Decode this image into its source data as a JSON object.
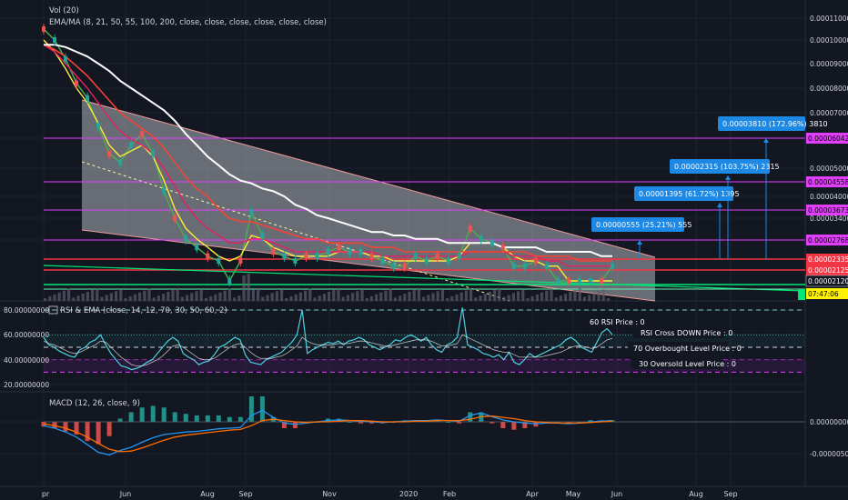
{
  "chart_data": [
    {
      "type": "line",
      "indicators": [
        "Vol (20)",
        "EMA/MA (8, 21, 50, 55, 100, 200, close, close, close, close, close, close)"
      ],
      "x_ticks": [
        "pr",
        "Jun",
        "Aug",
        "Sep",
        "Nov",
        "2020",
        "Feb",
        "Apr",
        "May",
        "Jun",
        "Aug",
        "Sep"
      ],
      "y_ticks": [
        "0.00011000",
        "0.00010000",
        "0.00009000",
        "0.00008000",
        "0.00007000",
        "0.00005000",
        "0.00004000",
        "0.00003400"
      ],
      "series": [
        {
          "values": [
            0.000105,
            0.0001,
            9.2e-05,
            8.2e-05,
            7.6e-05,
            6.5e-05,
            5.5e-05,
            5.2e-05,
            5.8e-05,
            6.2e-05,
            5.5e-05,
            4.2e-05,
            3.4e-05,
            2.8e-05,
            2.6e-05,
            2.4e-05,
            2.3e-05,
            2.1e-05,
            2.3e-05,
            3.6e-05,
            2.9e-05,
            2.5e-05,
            2.4e-05,
            2.3e-05,
            2.4e-05,
            2.4e-05,
            2.5e-05,
            2.6e-05,
            2.5e-05,
            2.5e-05,
            2.4e-05,
            2.3e-05,
            2.2e-05,
            2.2e-05,
            2.4e-05,
            2.3e-05,
            2.4e-05,
            2.3e-05,
            2.4e-05,
            3.1e-05,
            2.8e-05,
            2.7e-05,
            2.6e-05,
            2.2e-05,
            2.2e-05,
            2.3e-05,
            2.2e-05,
            2.1e-05,
            2.1e-05,
            2.1e-05,
            2.1e-05,
            2.1e-05,
            2.2e-05
          ]
        },
        {
          "values": [
            0.0001,
            9.5e-05,
            8.8e-05,
            8e-05,
            7.4e-05,
            6.6e-05,
            5.8e-05,
            5.4e-05,
            5.6e-05,
            5.8e-05,
            5.4e-05,
            4.6e-05,
            3.7e-05,
            3.1e-05,
            2.8e-05,
            2.6e-05,
            2.4e-05,
            2.3e-05,
            2.4e-05,
            2.9e-05,
            2.8e-05,
            2.6e-05,
            2.5e-05,
            2.4e-05,
            2.4e-05,
            2.4e-05,
            2.4e-05,
            2.5e-05,
            2.5e-05,
            2.5e-05,
            2.4e-05,
            2.4e-05,
            2.3e-05,
            2.3e-05,
            2.3e-05,
            2.3e-05,
            2.3e-05,
            2.3e-05,
            2.4e-05,
            2.7e-05,
            2.7e-05,
            2.7e-05,
            2.6e-05,
            2.4e-05,
            2.3e-05,
            2.3e-05,
            2.2e-05,
            2.2e-05,
            2.1e-05,
            2.1e-05,
            2.1e-05,
            2.1e-05,
            2.1e-05
          ]
        },
        {
          "values": [
            9.8e-05,
            9.5e-05,
            9e-05,
            8.5e-05,
            8e-05,
            7.4e-05,
            6.8e-05,
            6.3e-05,
            6e-05,
            5.8e-05,
            5.5e-05,
            5e-05,
            4.4e-05,
            3.8e-05,
            3.4e-05,
            3.1e-05,
            2.9e-05,
            2.7e-05,
            2.7e-05,
            2.8e-05,
            2.8e-05,
            2.7e-05,
            2.6e-05,
            2.5e-05,
            2.5e-05,
            2.5e-05,
            2.5e-05,
            2.5e-05,
            2.5e-05,
            2.5e-05,
            2.5e-05,
            2.4e-05,
            2.4e-05,
            2.4e-05,
            2.4e-05,
            2.4e-05,
            2.4e-05,
            2.4e-05,
            2.4e-05,
            2.5e-05,
            2.5e-05,
            2.5e-05,
            2.5e-05,
            2.4e-05,
            2.4e-05,
            2.4e-05,
            2.3e-05,
            2.3e-05,
            2.2e-05,
            2.2e-05,
            2.2e-05,
            2.2e-05,
            2.2e-05
          ]
        },
        {
          "values": [
            9.8e-05,
            9.6e-05,
            9.3e-05,
            8.9e-05,
            8.5e-05,
            8e-05,
            7.5e-05,
            7e-05,
            6.7e-05,
            6.4e-05,
            6.1e-05,
            5.7e-05,
            5.2e-05,
            4.7e-05,
            4.3e-05,
            4e-05,
            3.7e-05,
            3.4e-05,
            3.3e-05,
            3.3e-05,
            3.2e-05,
            3.1e-05,
            3e-05,
            2.9e-05,
            2.8e-05,
            2.8e-05,
            2.7e-05,
            2.7e-05,
            2.7e-05,
            2.7e-05,
            2.6e-05,
            2.6e-05,
            2.6e-05,
            2.5e-05,
            2.5e-05,
            2.5e-05,
            2.5e-05,
            2.5e-05,
            2.5e-05,
            2.5e-05,
            2.5e-05,
            2.5e-05,
            2.5e-05,
            2.5e-05,
            2.5e-05,
            2.4e-05,
            2.4e-05,
            2.4e-05,
            2.4e-05,
            2.3e-05,
            2.3e-05,
            2.3e-05,
            2.3e-05
          ]
        },
        {
          "values": [
            9.8e-05,
            9.8e-05,
            9.7e-05,
            9.5e-05,
            9.3e-05,
            9e-05,
            8.7e-05,
            8.3e-05,
            8e-05,
            7.7e-05,
            7.4e-05,
            7.1e-05,
            6.7e-05,
            6.2e-05,
            5.8e-05,
            5.4e-05,
            5.1e-05,
            4.8e-05,
            4.6e-05,
            4.5e-05,
            4.3e-05,
            4.2e-05,
            4e-05,
            3.8e-05,
            3.7e-05,
            3.5e-05,
            3.4e-05,
            3.3e-05,
            3.2e-05,
            3.1e-05,
            3e-05,
            3e-05,
            2.9e-05,
            2.9e-05,
            2.8e-05,
            2.8e-05,
            2.8e-05,
            2.7e-05,
            2.7e-05,
            2.7e-05,
            2.7e-05,
            2.7e-05,
            2.6e-05,
            2.6e-05,
            2.6e-05,
            2.6e-05,
            2.5e-05,
            2.5e-05,
            2.5e-05,
            2.5e-05,
            2.5e-05,
            2.4e-05,
            2.4e-05
          ]
        }
      ],
      "overlays": {
        "horizontal_levels": [
          6.042e-05,
          4.558e-05,
          3.673e-05,
          2.768e-05,
          2.335e-05,
          2.125e-05
        ],
        "price_tags": [
          {
            "text": "0.00006042",
            "color": "#e040fb",
            "text_color": "#000000"
          },
          {
            "text": "0.00004558",
            "color": "#e040fb",
            "text_color": "#000000"
          },
          {
            "text": "0.00003673",
            "color": "#e040fb",
            "text_color": "#000000"
          },
          {
            "text": "0.00002768",
            "color": "#e040fb",
            "text_color": "#000000"
          },
          {
            "text": "0.00002335",
            "color": "#f23645",
            "text_color": "#ffffff"
          },
          {
            "text": "0.00002125",
            "color": "#f23645",
            "text_color": "#ffffff"
          },
          {
            "text": "0.00002120",
            "color": "#131722",
            "text_color": "#ffffff"
          },
          {
            "text": "07:47:06",
            "color": "#fff200",
            "text_color": "#000000"
          }
        ],
        "target_boxes": [
          "0.00000555 (25.21%) 555",
          "0.00001395 (61.72%) 1395",
          "0.00002315 (103.75%) 2315",
          "0.00003810 (172.96%) 3810"
        ]
      },
      "colors": {
        "background": "#131722",
        "ema8": "#4caf50",
        "ema21": "#ffeb3b",
        "ema50": "#e91e63",
        "ma100": "#f44336",
        "ma200": "#ffffff",
        "channel": "#d1d4dc",
        "level": "#e040fb",
        "target": "#1e88e5"
      }
    },
    {
      "type": "line",
      "title": "RSI & EMA (close, 14, 12, 70, 30, 50, 60, 2)",
      "y_ticks": [
        "80.00000000",
        "60.00000000",
        "40.00000000",
        "20.00000000"
      ],
      "labels": [
        "60 RSI Price : 0",
        "RSI Cross DOWN Price : 0",
        "70 Overbought Level Price : 0",
        "30 Oversold Level Price : 0"
      ],
      "series": [
        {
          "values": [
            58,
            52,
            50,
            47,
            45,
            43,
            42,
            48,
            50,
            54,
            56,
            60,
            52,
            45,
            40,
            35,
            34,
            32,
            33,
            35,
            38,
            40,
            45,
            50,
            55,
            58,
            55,
            45,
            42,
            40,
            36,
            38,
            39,
            44,
            50,
            52,
            55,
            58,
            56,
            44,
            38,
            37,
            36,
            40,
            42,
            44,
            46,
            50,
            54,
            60,
            80,
            45,
            48,
            50,
            52,
            54,
            53,
            55,
            52,
            55,
            56,
            58,
            56,
            52,
            50,
            48,
            50,
            52,
            56,
            55,
            58,
            60,
            58,
            55,
            58,
            52,
            48,
            46,
            52,
            54,
            58,
            82,
            52,
            50,
            48,
            45,
            44,
            42,
            44,
            40,
            46,
            38,
            36,
            40,
            45,
            42,
            44,
            46,
            48,
            50,
            52,
            56,
            58,
            55,
            50,
            48,
            46,
            54,
            62,
            65,
            60
          ]
        },
        {
          "values": [
            55,
            53,
            52,
            50,
            48,
            46,
            45,
            46,
            48,
            50,
            52,
            55,
            54,
            50,
            46,
            42,
            39,
            36,
            35,
            35,
            36,
            38,
            40,
            43,
            47,
            51,
            52,
            50,
            47,
            44,
            41,
            40,
            40,
            41,
            44,
            47,
            50,
            52,
            53,
            50,
            46,
            43,
            41,
            41,
            41,
            42,
            43,
            45,
            48,
            51,
            58,
            55,
            53,
            52,
            52,
            52,
            52,
            53,
            53,
            53,
            54,
            55,
            55,
            54,
            53,
            52,
            51,
            51,
            52,
            53,
            54,
            55,
            56,
            56,
            56,
            55,
            53,
            51,
            51,
            52,
            53,
            60,
            58,
            56,
            54,
            52,
            50,
            48,
            47,
            46,
            46,
            44,
            42,
            42,
            42,
            42,
            42,
            43,
            44,
            45,
            46,
            48,
            50,
            51,
            51,
            50,
            49,
            50,
            53,
            56,
            57
          ]
        }
      ],
      "levels": [
        80,
        60,
        50,
        40,
        30
      ]
    },
    {
      "type": "bar",
      "title": "MACD (12, 26, close, 9)",
      "y_ticks": [
        "0.00000000",
        "-0.00000500"
      ],
      "series": [
        {
          "values": [
            -6e-07,
            -1e-06,
            -1.6e-06,
            -2.4e-06,
            -3.6e-06,
            -4.8e-06,
            -5.2e-06,
            -4.5e-06,
            -4e-06,
            -3.2e-06,
            -2.5e-06,
            -2e-06,
            -1.8e-06,
            -1.6e-06,
            -1.5e-06,
            -1.3e-06,
            -1.1e-06,
            -1e-06,
            -9e-07,
            1e-06,
            1.8e-06,
            7e-07,
            -2e-07,
            -4e-07,
            -2e-07,
            0,
            2e-07,
            3e-07,
            2e-07,
            1e-07,
            0,
            -1e-07,
            0,
            1e-07,
            2e-07,
            2e-07,
            3e-07,
            2e-07,
            1e-07,
            1e-06,
            1.4e-06,
            8e-07,
            3e-07,
            0,
            -2e-07,
            -3e-07,
            -2e-07,
            -2e-07,
            -3e-07,
            -2e-07,
            0,
            1e-07,
            2e-07
          ]
        },
        {
          "values": [
            -3e-07,
            -6e-07,
            -1e-06,
            -1.6e-06,
            -2.4e-06,
            -3.4e-06,
            -4.3e-06,
            -4.7e-06,
            -4.6e-06,
            -4.1e-06,
            -3.5e-06,
            -2.9e-06,
            -2.4e-06,
            -2.1e-06,
            -1.9e-06,
            -1.7e-06,
            -1.5e-06,
            -1.3e-06,
            -1.2e-06,
            -6e-07,
            2e-07,
            4e-07,
            2e-07,
            0,
            -1e-07,
            0,
            0,
            1e-07,
            2e-07,
            2e-07,
            1e-07,
            0,
            0,
            0,
            1e-07,
            1e-07,
            2e-07,
            2e-07,
            2e-07,
            4e-07,
            8e-07,
            9e-07,
            7e-07,
            5e-07,
            2e-07,
            0,
            -1e-07,
            -2e-07,
            -2e-07,
            -2e-07,
            -1e-07,
            0,
            1e-07
          ]
        }
      ]
    }
  ]
}
